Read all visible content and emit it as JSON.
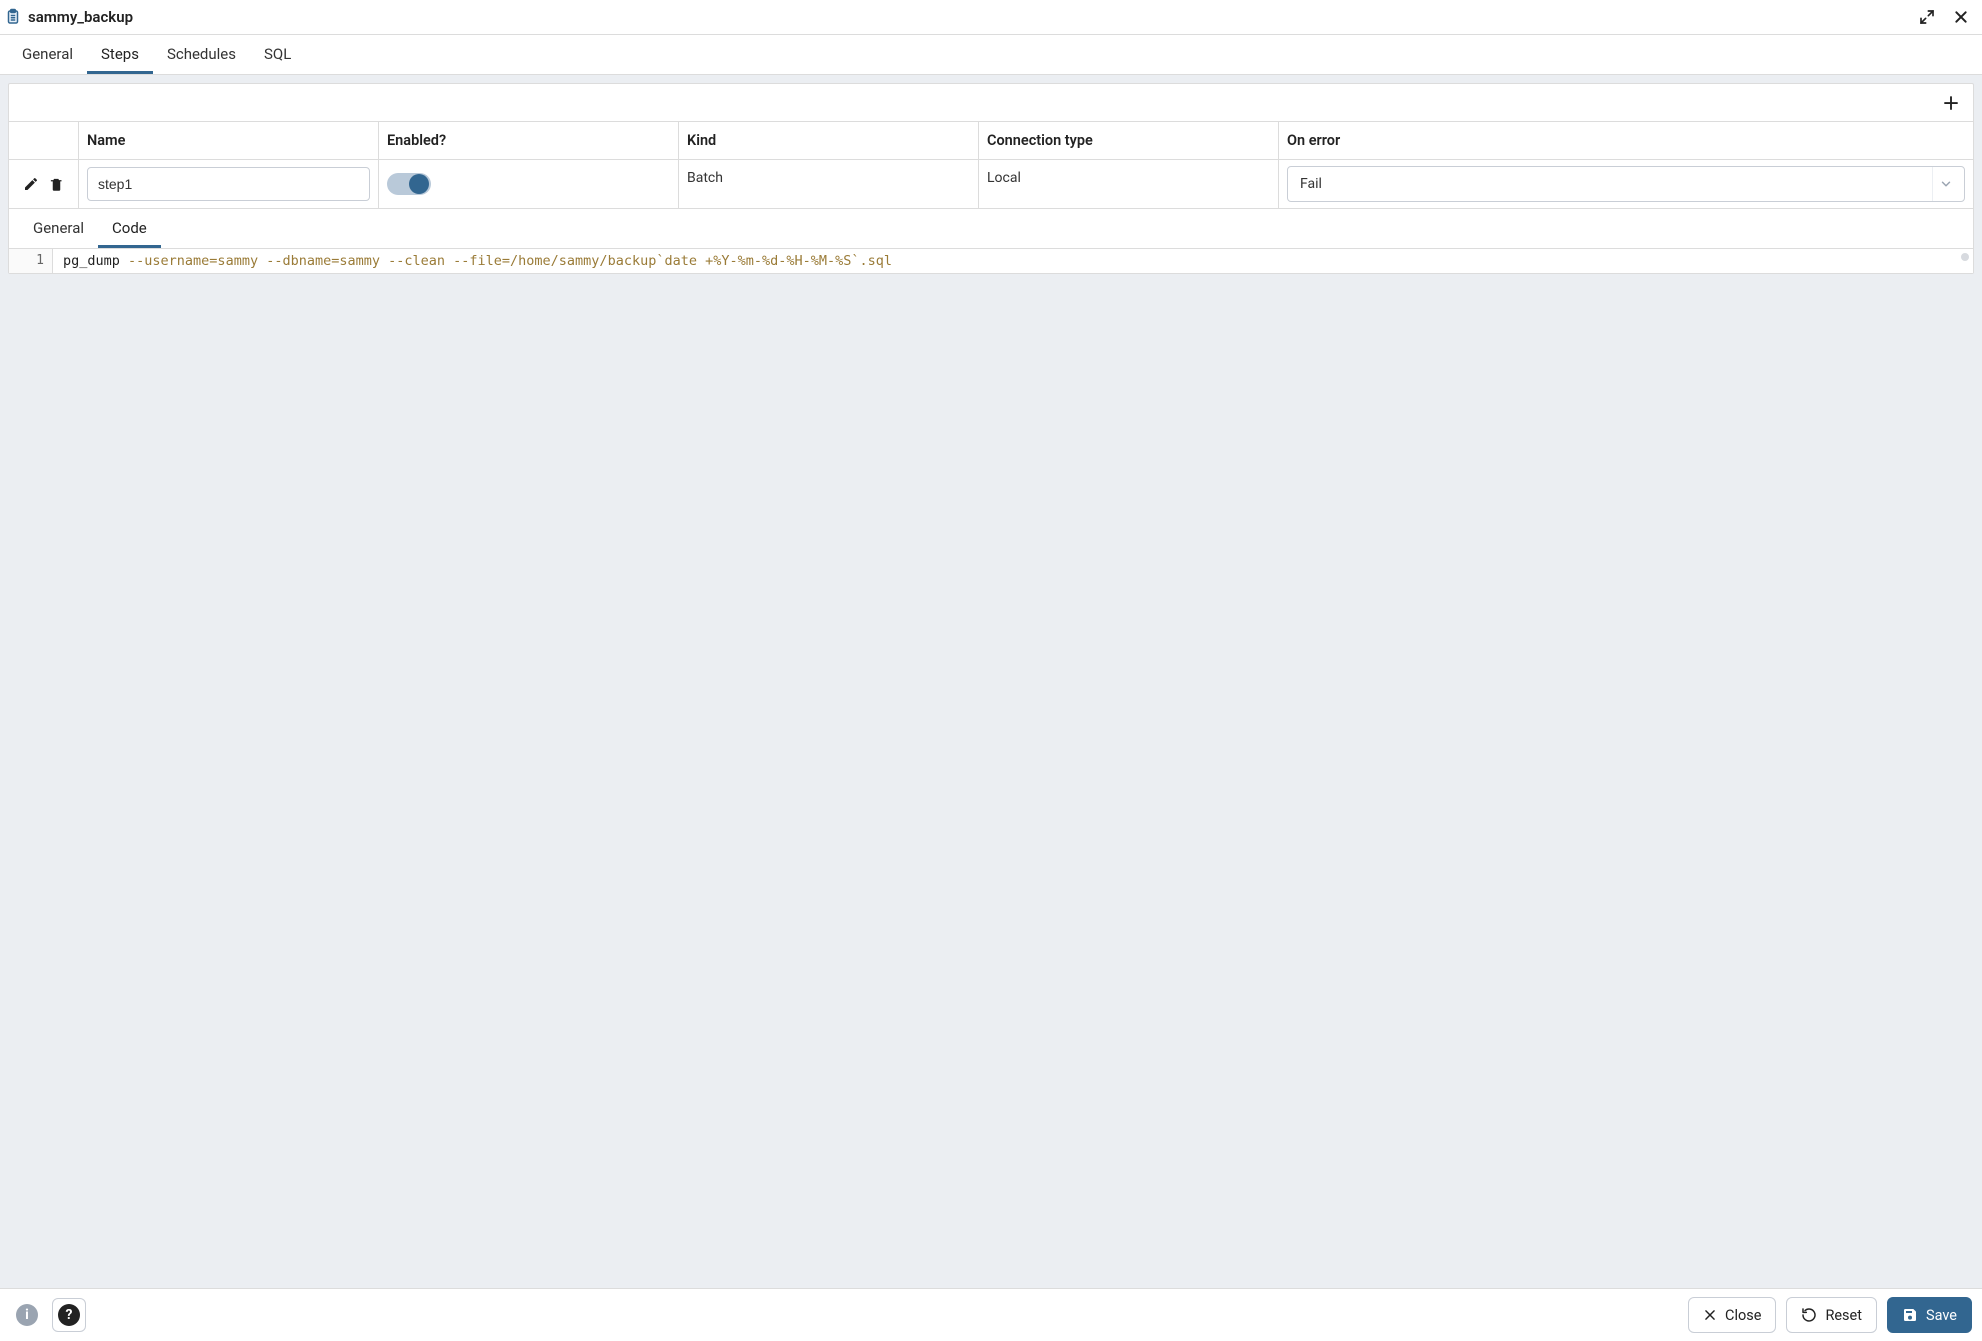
{
  "title": "sammy_backup",
  "tabs": {
    "general": "General",
    "steps": "Steps",
    "schedules": "Schedules",
    "sql": "SQL",
    "active": "steps"
  },
  "grid": {
    "headers": {
      "name": "Name",
      "enabled": "Enabled?",
      "kind": "Kind",
      "connection": "Connection type",
      "onerror": "On error"
    },
    "row": {
      "name": "step1",
      "enabled": true,
      "kind": "Batch",
      "connection": "Local",
      "onerror": "Fail"
    }
  },
  "subtabs": {
    "general": "General",
    "code": "Code",
    "active": "code"
  },
  "code": {
    "line_number": "1",
    "cmd": "pg_dump ",
    "args": "--username=sammy --dbname=sammy --clean --file=/home/sammy/backup`date +%Y-%m-%d-%H-%M-%S`.sql"
  },
  "footer": {
    "close": "Close",
    "reset": "Reset",
    "save": "Save"
  }
}
